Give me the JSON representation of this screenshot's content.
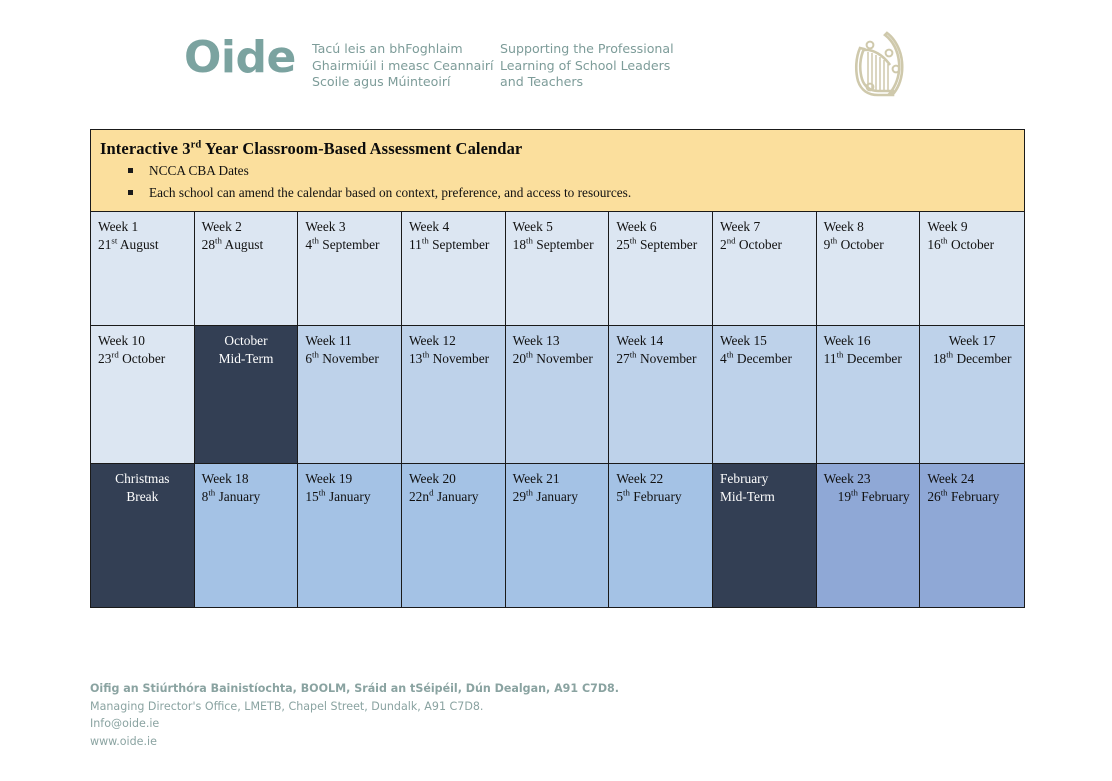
{
  "brand": {
    "wordmark": "Oide",
    "tagline_ga": "Tacú leis an bhFoghlaim\nGhairmiúil i measc Ceannairí\nScoile agus Múinteoirí",
    "tagline_en": "Supporting the Professional\nLearning of School Leaders\nand Teachers",
    "logo_icon": "irish-harp-icon",
    "color": "#7ba3a0"
  },
  "calendar": {
    "title_prefix": "Interactive 3",
    "title_sup": "rd",
    "title_suffix": " Year Classroom-Based Assessment Calendar",
    "banner_color": "#fbdf9d",
    "bullets": [
      "NCCA CBA Dates",
      "Each school can amend the calendar based on context, preference, and access to resources."
    ],
    "colors": {
      "tone_1": "#dce6f2",
      "tone_2": "#bed2ea",
      "tone_3": "#a4c2e5",
      "tone_4": "#8fa8d6",
      "break": "#333f54"
    },
    "rows": [
      {
        "name": "row-1",
        "cells": [
          {
            "line1": "Week 1",
            "line2_pre": "21",
            "line2_sup": "st",
            "line2_post": " August",
            "tone": "tone-1",
            "align": "left"
          },
          {
            "line1": "Week 2",
            "line2_pre": "28",
            "line2_sup": "th",
            "line2_post": " August",
            "tone": "tone-1",
            "align": "left"
          },
          {
            "line1": "Week 3",
            "line2_pre": "4",
            "line2_sup": "th",
            "line2_post": " September",
            "tone": "tone-1",
            "align": "left"
          },
          {
            "line1": "Week 4",
            "line2_pre": "11",
            "line2_sup": "th",
            "line2_post": " September",
            "tone": "tone-1",
            "align": "left"
          },
          {
            "line1": "Week 5",
            "line2_pre": "18",
            "line2_sup": "th",
            "line2_post": " September",
            "tone": "tone-1",
            "align": "left"
          },
          {
            "line1": "Week 6",
            "line2_pre": "25",
            "line2_sup": "th",
            "line2_post": " September",
            "tone": "tone-1",
            "align": "left"
          },
          {
            "line1": "Week 7",
            "line2_pre": "2",
            "line2_sup": "nd",
            "line2_post": " October",
            "tone": "tone-1",
            "align": "left"
          },
          {
            "line1": "Week 8",
            "line2_pre": "9",
            "line2_sup": "th",
            "line2_post": " October",
            "tone": "tone-1",
            "align": "left"
          },
          {
            "line1": "Week 9",
            "line2_pre": "16",
            "line2_sup": "th",
            "line2_post": " October",
            "tone": "tone-1",
            "align": "left"
          }
        ]
      },
      {
        "name": "row-2",
        "cells": [
          {
            "line1": "Week 10",
            "line2_pre": "23",
            "line2_sup": "rd",
            "line2_post": " October",
            "tone": "tone-1",
            "align": "left"
          },
          {
            "line1": "October",
            "line2_pre": "Mid-Term",
            "line2_sup": "",
            "line2_post": "",
            "tone": "tone-dark",
            "align": "center"
          },
          {
            "line1": "Week 11",
            "line2_pre": "6",
            "line2_sup": "th",
            "line2_post": " November",
            "tone": "tone-2",
            "align": "left"
          },
          {
            "line1": "Week 12",
            "line2_pre": "13",
            "line2_sup": "th",
            "line2_post": " November",
            "tone": "tone-2",
            "align": "left"
          },
          {
            "line1": "Week 13",
            "line2_pre": "20",
            "line2_sup": "th",
            "line2_post": " November",
            "tone": "tone-2",
            "align": "left"
          },
          {
            "line1": "Week 14",
            "line2_pre": "27",
            "line2_sup": "th",
            "line2_post": " November",
            "tone": "tone-2",
            "align": "left"
          },
          {
            "line1": "Week 15",
            "line2_pre": "4",
            "line2_sup": "th",
            "line2_post": " December",
            "tone": "tone-2",
            "align": "left"
          },
          {
            "line1": "Week 16",
            "line2_pre": "11",
            "line2_sup": "th",
            "line2_post": " December",
            "tone": "tone-2",
            "align": "left"
          },
          {
            "line1": "Week 17",
            "line2_pre": "18",
            "line2_sup": "th",
            "line2_post": " December",
            "tone": "tone-2",
            "align": "center"
          }
        ]
      },
      {
        "name": "row-3",
        "cells": [
          {
            "line1": "Christmas",
            "line2_pre": "Break",
            "line2_sup": "",
            "line2_post": "",
            "tone": "tone-dark",
            "align": "center"
          },
          {
            "line1": "Week 18",
            "line2_pre": "8",
            "line2_sup": "th",
            "line2_post": " January",
            "tone": "tone-3",
            "align": "left"
          },
          {
            "line1": "Week 19",
            "line2_pre": "15",
            "line2_sup": "th",
            "line2_post": " January",
            "tone": "tone-3",
            "align": "left"
          },
          {
            "line1": "Week 20",
            "line2_pre": "22n",
            "line2_sup": "d",
            "line2_post": " January",
            "tone": "tone-3",
            "align": "left"
          },
          {
            "line1": "Week 21",
            "line2_pre": "29",
            "line2_sup": "th",
            "line2_post": " January",
            "tone": "tone-3",
            "align": "left"
          },
          {
            "line1": "Week 22",
            "line2_pre": "5",
            "line2_sup": "th",
            "line2_post": " February",
            "tone": "tone-3",
            "align": "left"
          },
          {
            "line1": "February",
            "line2_pre": "Mid-Term",
            "line2_sup": "",
            "line2_post": "",
            "tone": "tone-dark",
            "align": "left"
          },
          {
            "line1": "Week 23",
            "line2_pre": "19",
            "line2_sup": "th",
            "line2_post": " February",
            "tone": "tone-4",
            "align": "indent"
          },
          {
            "line1": "Week 24",
            "line2_pre": "26",
            "line2_sup": "th",
            "line2_post": " February",
            "tone": "tone-4",
            "align": "left"
          }
        ]
      }
    ]
  },
  "footer": {
    "line1": "Oifig an Stiúrthóra Bainistíochta, BOOLM, Sráid an tSéipéil, Dún Dealgan, A91 C7D8.",
    "line2": "Managing Director's Office, LMETB, Chapel Street, Dundalk, A91 C7D8.",
    "line3": "Info@oide.ie",
    "line4": "www.oide.ie"
  }
}
